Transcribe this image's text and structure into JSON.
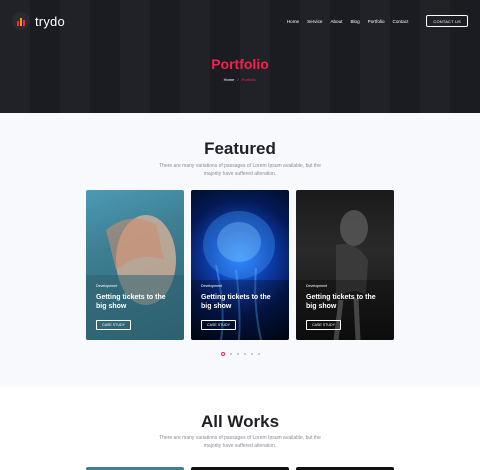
{
  "brand": {
    "name": "trydo",
    "bar_colors": [
      "#f81f4a",
      "#ff9a00",
      "#f81f4a"
    ]
  },
  "nav": {
    "items": [
      {
        "label": "Home"
      },
      {
        "label": "Service"
      },
      {
        "label": "About"
      },
      {
        "label": "Blog"
      },
      {
        "label": "Portfolio"
      },
      {
        "label": "Contact"
      }
    ],
    "cta_label": "CONTACT US"
  },
  "hero": {
    "title": "Portfolio",
    "breadcrumb": {
      "home": "Home",
      "separator": "/",
      "current": "Portfolio"
    }
  },
  "featured": {
    "title": "Featured",
    "description": "There are many variations of passages of Lorem Ipsum available, but the majority have suffered alteration.",
    "cards": [
      {
        "category": "Development",
        "title": "Getting tickets to the big show",
        "button": "CASE STUDY",
        "image": "woman-face-teal"
      },
      {
        "category": "Development",
        "title": "Getting tickets to the big show",
        "button": "CASE STUDY",
        "image": "blue-jellyfish"
      },
      {
        "category": "Development",
        "title": "Getting tickets to the big show",
        "button": "CASE STUDY",
        "image": "bw-woman-portrait"
      }
    ],
    "pagination": {
      "count": 6,
      "active_index": 0
    }
  },
  "all_works": {
    "title": "All Works",
    "description": "There are many variations of passages of Lorem Ipsum available, but the majority have suffered alteration."
  },
  "colors": {
    "accent": "#f81f4a",
    "dark": "#1b1b22",
    "text": "#1f1f25",
    "muted": "#8c8c97"
  }
}
